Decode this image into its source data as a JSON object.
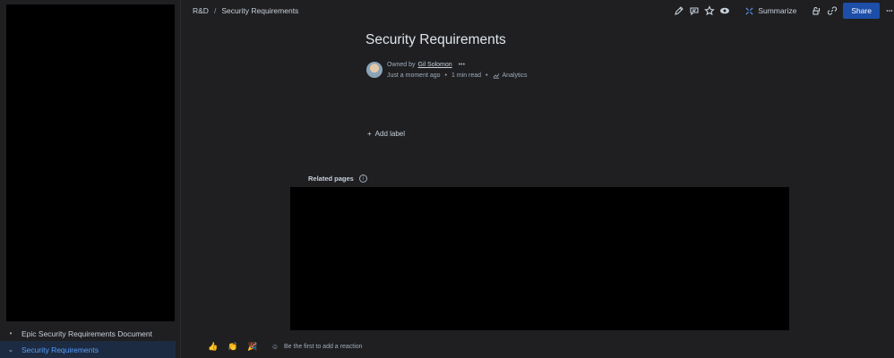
{
  "breadcrumb": {
    "space": "R&D",
    "separator": "/",
    "page": "Security Requirements"
  },
  "toolbar": {
    "summarize_label": "Summarize",
    "share_label": "Share"
  },
  "page": {
    "title": "Security Requirements",
    "owned_by_label": "Owned by",
    "owner": "Gil Solomon",
    "edited": "Just a moment ago",
    "read_time": "1 min read",
    "analytics_label": "Analytics",
    "add_label": "Add label",
    "related_pages_label": "Related pages"
  },
  "sidebar": {
    "items": [
      {
        "label": "Epic Security Requirements Document",
        "bullet": "•"
      },
      {
        "label": "Security Requirements",
        "bullet": "⌄"
      }
    ]
  },
  "reactions": {
    "emojis": [
      "👍",
      "👏",
      "🎉"
    ],
    "prompt": "Be the first to add a reaction"
  },
  "colors": {
    "accent": "#579dff",
    "share_button": "#1d4ea8",
    "background": "#1f1f21"
  },
  "icons": [
    "pencil-icon",
    "comment-icon",
    "star-icon",
    "eye-icon",
    "summarize-icon",
    "restriction-icon",
    "link-icon",
    "more-icon",
    "info-icon",
    "analytics-icon",
    "plus-icon",
    "add-reaction-icon"
  ]
}
